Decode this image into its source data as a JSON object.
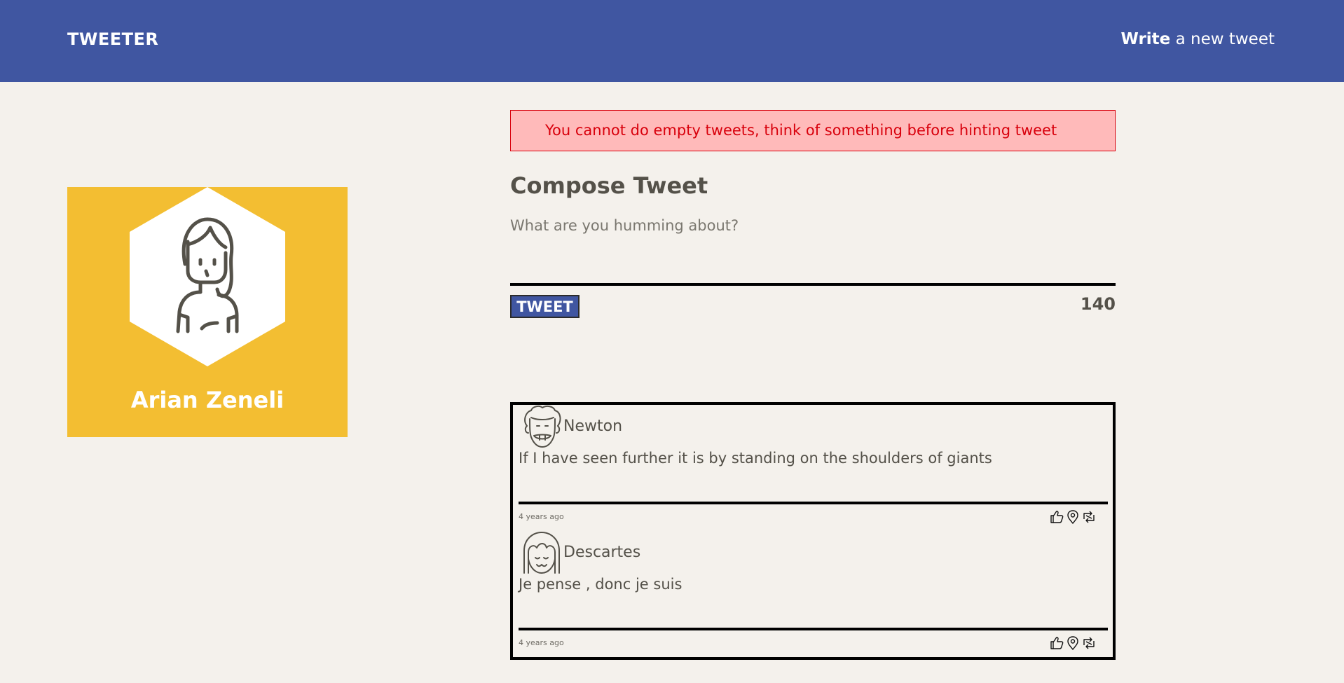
{
  "nav": {
    "brand": "TWEETER",
    "write_bold": "Write",
    "write_rest": " a new tweet"
  },
  "profile": {
    "name": "Arian Zeneli"
  },
  "error": {
    "message": "You cannot do empty tweets, think of something before hinting tweet"
  },
  "compose": {
    "title": "Compose Tweet",
    "placeholder": "What are you humming about?",
    "value": "",
    "button_label": "TWEET",
    "counter": "140"
  },
  "tweets": [
    {
      "author": "Newton",
      "text": "If I have seen further it is by standing on the shoulders of giants",
      "time": "4 years ago"
    },
    {
      "author": "Descartes",
      "text": "Je pense , donc je suis",
      "time": "4 years ago"
    }
  ],
  "colors": {
    "nav": "#4056a1",
    "background": "#f4f1ec",
    "profile": "#f3be32",
    "error_bg": "#ffbaba",
    "error_text": "#d8000c",
    "text": "#545149"
  },
  "icons": {
    "like": "thumbs-up-icon",
    "location": "map-pin-icon",
    "retweet": "retweet-icon"
  }
}
